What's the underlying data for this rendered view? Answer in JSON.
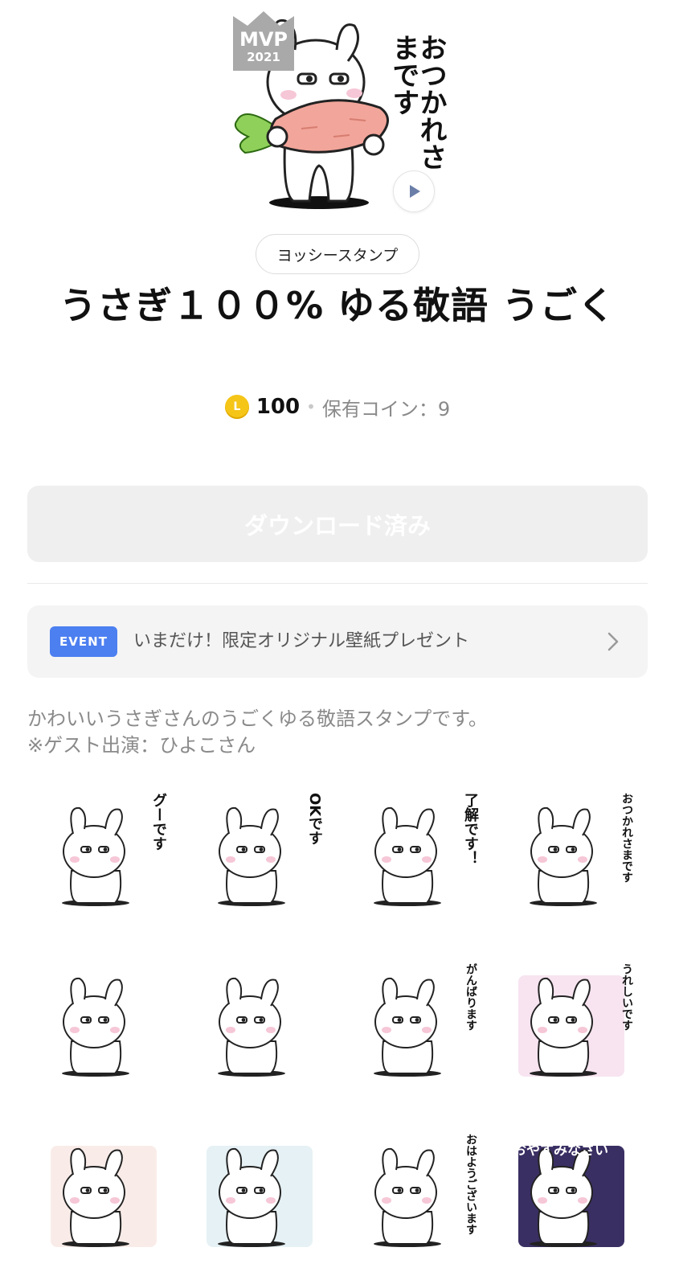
{
  "hero": {
    "badge_label": "MVP",
    "badge_year": "2021",
    "greeting_text": "おつかれさまです"
  },
  "creator": "ヨッシースタンプ",
  "title": "うさぎ１００% ゆる敬語 うごく",
  "price": {
    "coin_letter": "L",
    "amount": "100",
    "separator": "•",
    "owned_label": "保有コイン：9"
  },
  "download_button": "ダウンロード済み",
  "event": {
    "badge": "EVENT",
    "text": "いまだけ！限定オリジナル壁紙プレゼント"
  },
  "description": {
    "line1": "かわいいうさぎさんのうごくゆる敬語スタンプです。",
    "line2": "※ゲスト出演：ひよこさん"
  },
  "stickers": [
    {
      "caption": "グーです",
      "bg": "#ffffff"
    },
    {
      "caption": "OKです",
      "bg": "#ffffff"
    },
    {
      "caption": "了解です！",
      "bg": "#ffffff"
    },
    {
      "caption": "おつかれさまです",
      "bg": "#ffffff"
    },
    {
      "caption": "",
      "bg": "#ffffff"
    },
    {
      "caption": "",
      "bg": "#ffffff"
    },
    {
      "caption": "がんばります",
      "bg": "#ffffff"
    },
    {
      "caption": "うれしいです",
      "bg": "#f7e4f0"
    },
    {
      "caption": "",
      "bg": "#f9ece8"
    },
    {
      "caption": "",
      "bg": "#e6f1f5"
    },
    {
      "caption": "おはようございます",
      "bg": "#ffffff"
    },
    {
      "caption": "おやすみなさい",
      "bg": "#3a2f63"
    }
  ],
  "colors": {
    "event_badge": "#4c7ff0",
    "coin": "#f5c518",
    "download_bg": "#efefef"
  }
}
